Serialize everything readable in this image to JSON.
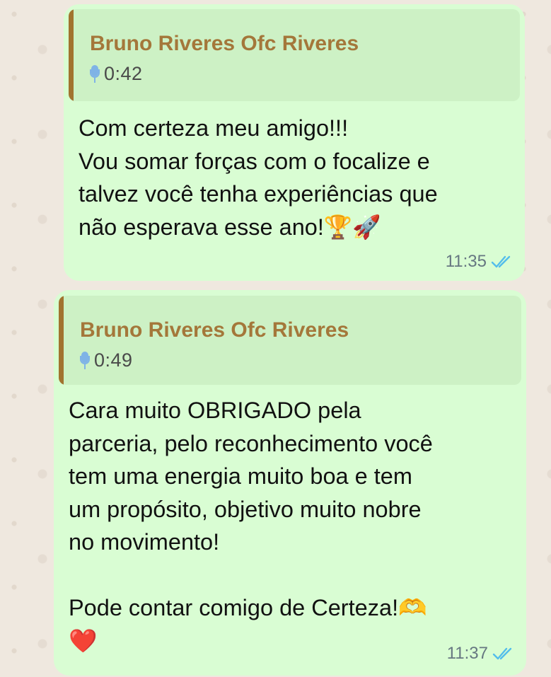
{
  "messages": [
    {
      "quoted": {
        "author": "Bruno Riveres Ofc Riveres",
        "audio_duration": "0:42",
        "icon": "mic-icon"
      },
      "lines": [
        "Com certeza meu amigo!!!",
        "Vou somar forças com o focalize e",
        "talvez você tenha experiências que",
        "não esperava esse ano!🏆🚀"
      ],
      "time": "11:35",
      "status_icon": "double-check-icon"
    },
    {
      "quoted": {
        "author": "Bruno Riveres Ofc Riveres",
        "audio_duration": "0:49",
        "icon": "mic-icon"
      },
      "lines": [
        "Cara muito OBRIGADO pela",
        "parceria, pelo reconhecimento você",
        "tem uma energia muito boa e tem",
        "um propósito, objetivo muito nobre",
        "no movimento!",
        "",
        "Pode contar comigo de Certeza!🫶",
        "❤️"
      ],
      "time": "11:37",
      "status_icon": "double-check-icon"
    }
  ],
  "colors": {
    "bubble": "#d9fdd3",
    "quote_bg": "#cdf1c5",
    "quote_bar": "#a1732f",
    "author": "#a4773a",
    "mic": "#7fb3e6",
    "read_check": "#53bdeb",
    "time": "#667781"
  }
}
